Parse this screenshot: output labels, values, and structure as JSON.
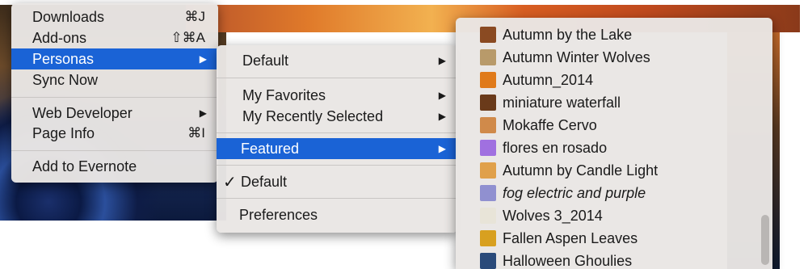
{
  "menu1": {
    "items": [
      {
        "label": "Downloads",
        "shortcut": "⌘J"
      },
      {
        "label": "Add-ons",
        "shortcut": "⇧⌘A"
      },
      {
        "label": "Personas"
      },
      {
        "label": "Sync Now"
      },
      {
        "label": "Web Developer"
      },
      {
        "label": "Page Info",
        "shortcut": "⌘I"
      },
      {
        "label": "Add to Evernote"
      }
    ]
  },
  "menu2": {
    "items": [
      {
        "label": "Default"
      },
      {
        "label": "My Favorites"
      },
      {
        "label": "My Recently Selected"
      },
      {
        "label": "Featured"
      },
      {
        "label": "Default",
        "check": "✓"
      },
      {
        "label": "Preferences"
      }
    ]
  },
  "menu3": {
    "items": [
      {
        "label": "Autumn by the Lake",
        "color": "#8a4a22"
      },
      {
        "label": "Autumn Winter Wolves",
        "color": "#b89a6a"
      },
      {
        "label": "Autumn_2014",
        "color": "#e07a1a"
      },
      {
        "label": "miniature waterfall",
        "color": "#6a3a1a"
      },
      {
        "label": "Mokaffe Cervo",
        "color": "#d08a4a"
      },
      {
        "label": "flores en rosado",
        "color": "#a070e0"
      },
      {
        "label": "Autumn by Candle Light",
        "color": "#e0a04a"
      },
      {
        "label": "fog electric and purple",
        "color": "#9090d0"
      },
      {
        "label": "Wolves 3_2014",
        "color": "#e8e4d8"
      },
      {
        "label": "Fallen Aspen Leaves",
        "color": "#d8a020"
      },
      {
        "label": "Halloween Ghoulies",
        "color": "#2a4a7a"
      }
    ]
  }
}
